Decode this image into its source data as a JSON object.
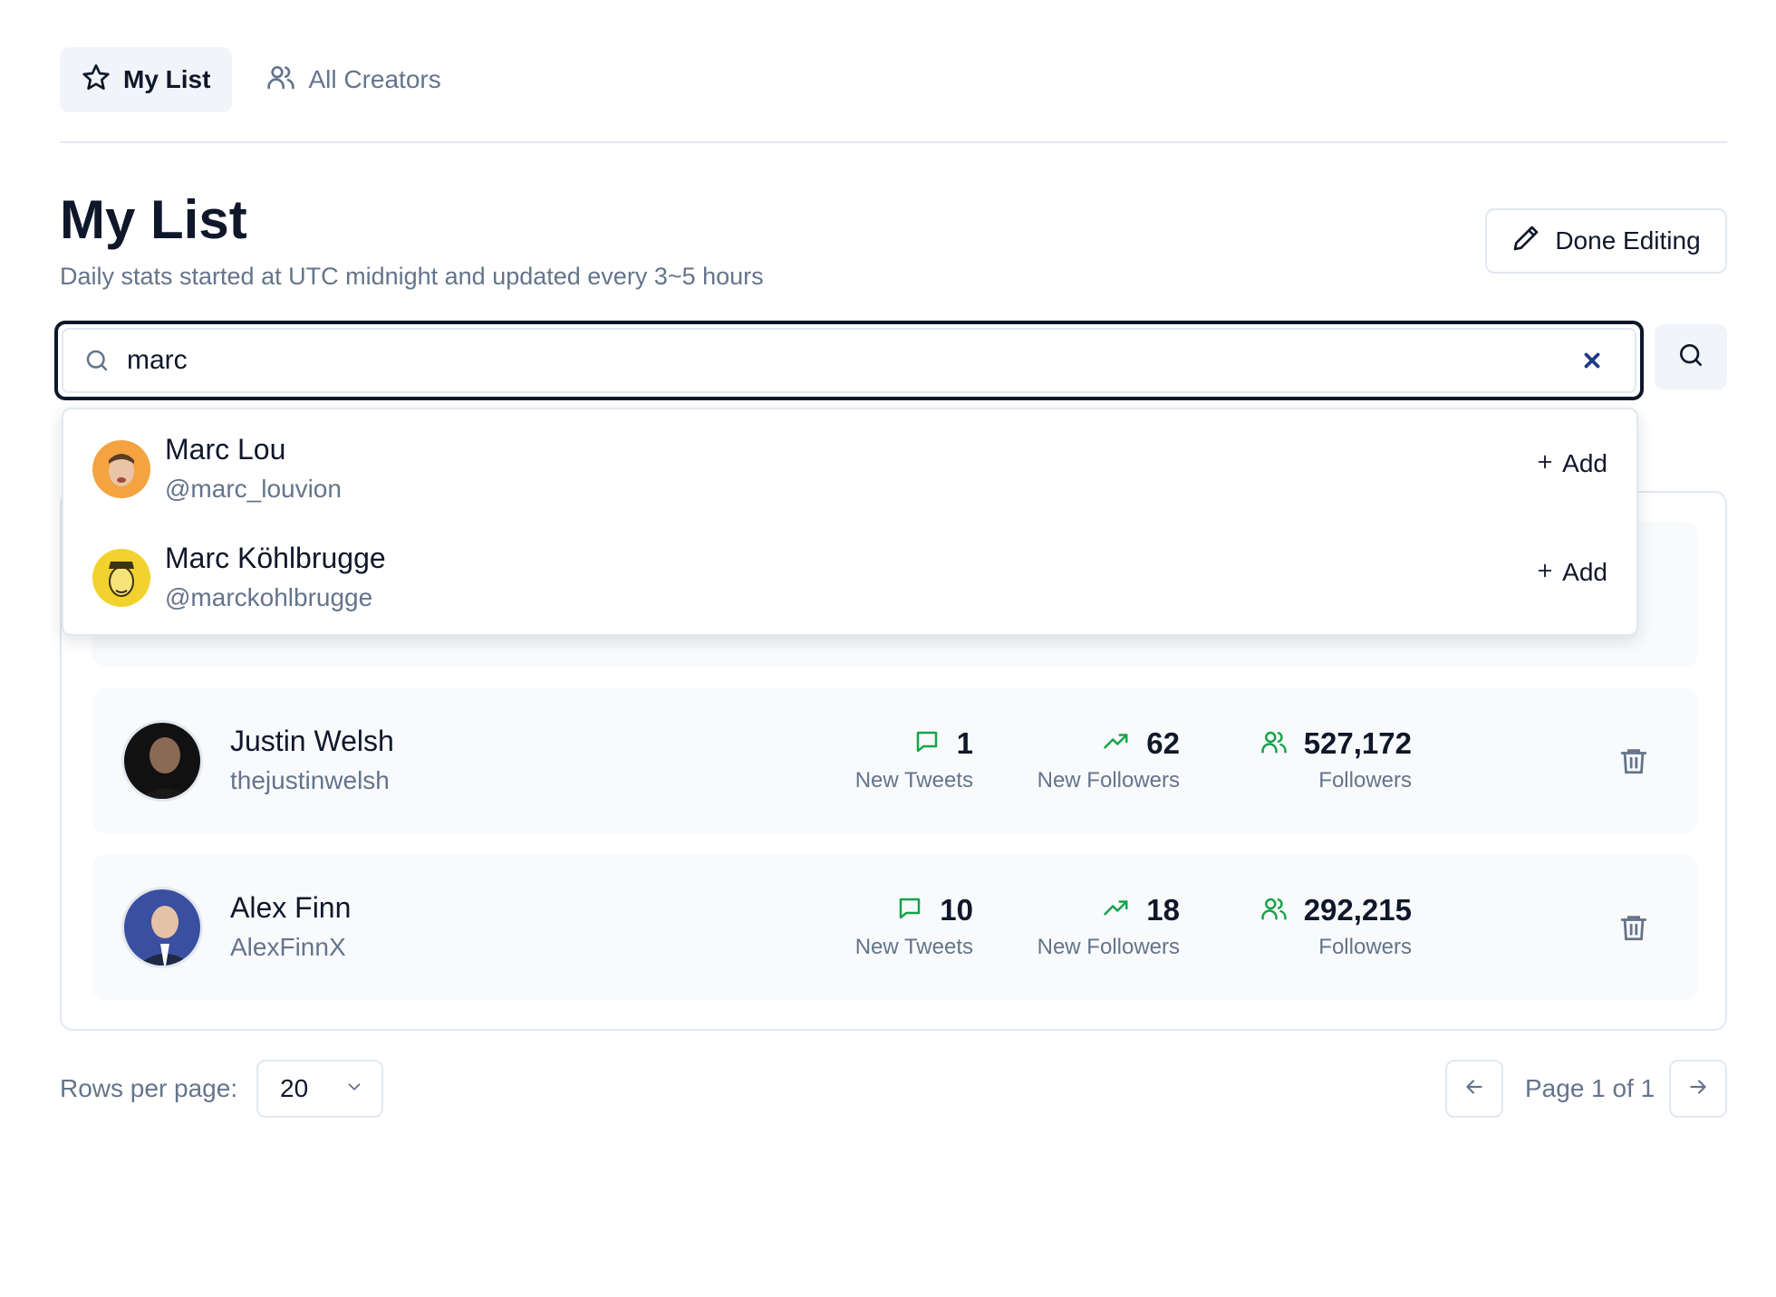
{
  "tabs": [
    {
      "label": "My List",
      "icon": "star-icon",
      "active": true
    },
    {
      "label": "All Creators",
      "icon": "users-icon",
      "active": false
    }
  ],
  "header": {
    "title": "My List",
    "subtitle": "Daily stats started at UTC midnight and updated every 3~5 hours",
    "edit_button": "Done Editing"
  },
  "search": {
    "value": "marc",
    "placeholder": ""
  },
  "suggestions": [
    {
      "name": "Marc Lou",
      "handle": "@marc_louvion",
      "action": "Add"
    },
    {
      "name": "Marc Köhlbrugge",
      "handle": "@marckohlbrugge",
      "action": "Add"
    }
  ],
  "creators": [
    {
      "name": "Justin Welsh",
      "handle": "thejustinwelsh",
      "new_tweets": "1",
      "new_tweets_label": "New Tweets",
      "new_followers": "62",
      "new_followers_label": "New Followers",
      "followers": "527,172",
      "followers_label": "Followers"
    },
    {
      "name": "Alex Finn",
      "handle": "AlexFinnX",
      "new_tweets": "10",
      "new_tweets_label": "New Tweets",
      "new_followers": "18",
      "new_followers_label": "New Followers",
      "followers": "292,215",
      "followers_label": "Followers"
    }
  ],
  "pagination": {
    "rows_label": "Rows per page:",
    "rows_value": "20",
    "page_info": "Page 1 of 1"
  },
  "colors": {
    "accent_green": "#16a34a",
    "muted": "#64748b",
    "border": "#e2e8f0"
  }
}
